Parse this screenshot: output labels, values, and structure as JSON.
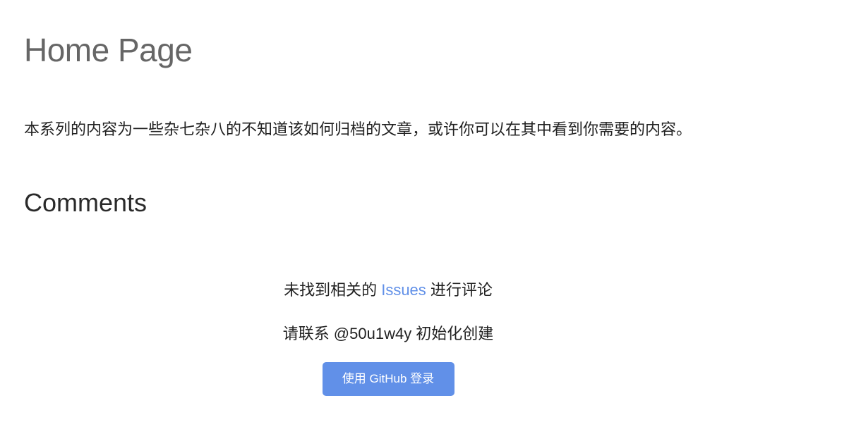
{
  "page": {
    "title": "Home Page",
    "intro": "本系列的内容为一些杂七杂八的不知道该如何归档的文章，或许你可以在其中看到你需要的内容。"
  },
  "comments": {
    "heading": "Comments",
    "no_issue_prefix": "未找到相关的 ",
    "issues_link": "Issues",
    "no_issue_suffix": " 进行评论",
    "contact_text": "请联系 @50u1w4y 初始化创建",
    "login_button": "使用 GitHub 登录"
  },
  "colors": {
    "accent": "#6190e8",
    "title_gray": "#666666",
    "text": "#222222"
  }
}
